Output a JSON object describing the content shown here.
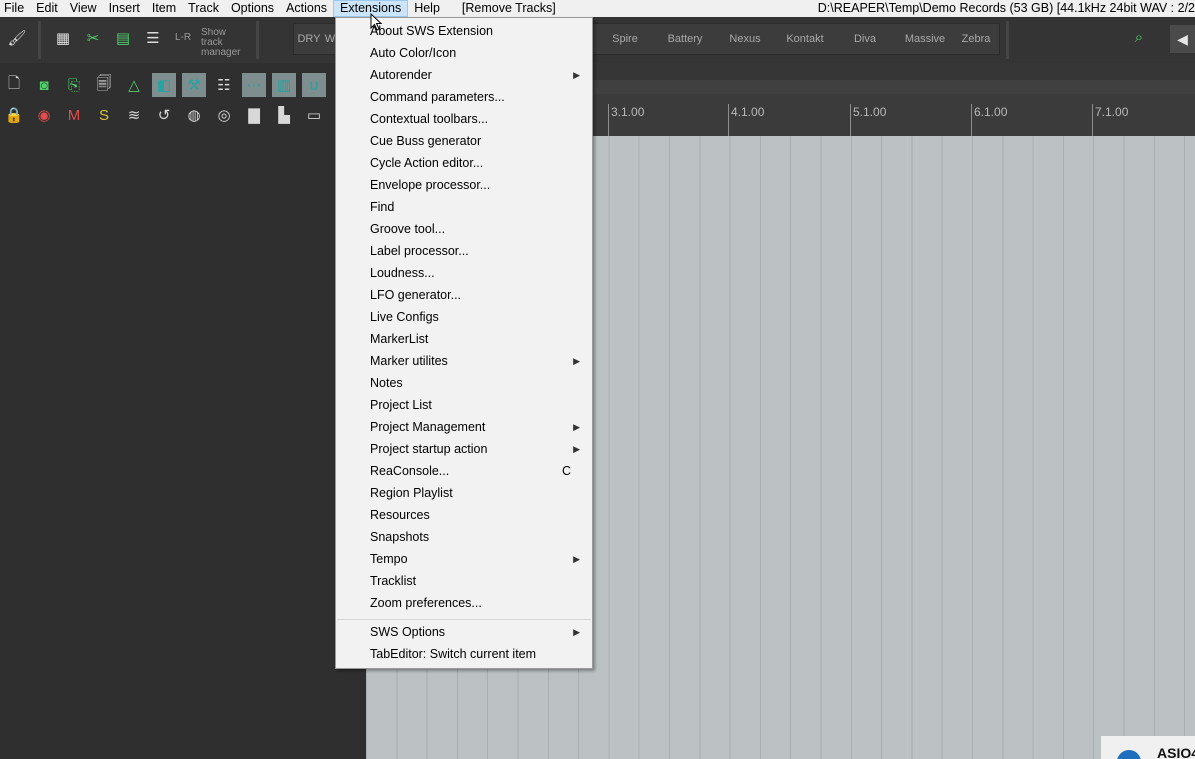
{
  "menubar": {
    "items": [
      {
        "label": "File"
      },
      {
        "label": "Edit"
      },
      {
        "label": "View"
      },
      {
        "label": "Insert"
      },
      {
        "label": "Item"
      },
      {
        "label": "Track"
      },
      {
        "label": "Options"
      },
      {
        "label": "Actions"
      },
      {
        "label": "Extensions",
        "active": true
      },
      {
        "label": "Help"
      }
    ],
    "extra": "[Remove Tracks]",
    "status": "D:\\REAPER\\Temp\\Demo Records (53 GB) [44.1kHz 24bit WAV : 2/2"
  },
  "toolbar": {
    "lr_label": "L-R",
    "show_track_label": "Show track manager",
    "fx_buttons": [
      "DRY",
      "W",
      "Spire",
      "Battery",
      "Nexus",
      "Kontakt",
      "Diva",
      "Massive",
      "Zebra"
    ],
    "accent": "#4fd16b"
  },
  "ruler": {
    "markers": [
      "3.1.00",
      "4.1.00",
      "5.1.00",
      "6.1.00",
      "7.1.00"
    ]
  },
  "extensions_menu": {
    "items": [
      {
        "label": "About SWS Extension"
      },
      {
        "label": "Auto Color/Icon"
      },
      {
        "label": "Autorender",
        "submenu": true
      },
      {
        "label": "Command parameters..."
      },
      {
        "label": "Contextual toolbars..."
      },
      {
        "label": "Cue Buss generator"
      },
      {
        "label": "Cycle Action editor..."
      },
      {
        "label": "Envelope processor..."
      },
      {
        "label": "Find"
      },
      {
        "label": "Groove tool..."
      },
      {
        "label": "Label processor..."
      },
      {
        "label": "Loudness..."
      },
      {
        "label": "LFO generator..."
      },
      {
        "label": "Live Configs"
      },
      {
        "label": "MarkerList"
      },
      {
        "label": "Marker utilites",
        "submenu": true
      },
      {
        "label": "Notes"
      },
      {
        "label": "Project List"
      },
      {
        "label": "Project Management",
        "submenu": true
      },
      {
        "label": "Project startup action",
        "submenu": true
      },
      {
        "label": "ReaConsole...",
        "shortcut": "C"
      },
      {
        "label": "Region Playlist"
      },
      {
        "label": "Resources"
      },
      {
        "label": "Snapshots"
      },
      {
        "label": "Tempo",
        "submenu": true
      },
      {
        "label": "Tracklist"
      },
      {
        "label": "Zoom preferences..."
      }
    ],
    "footer_items": [
      {
        "label": "SWS Options",
        "submenu": true
      },
      {
        "label": "TabEditor: Switch current item"
      }
    ]
  },
  "asio_badge": "ASIO4"
}
